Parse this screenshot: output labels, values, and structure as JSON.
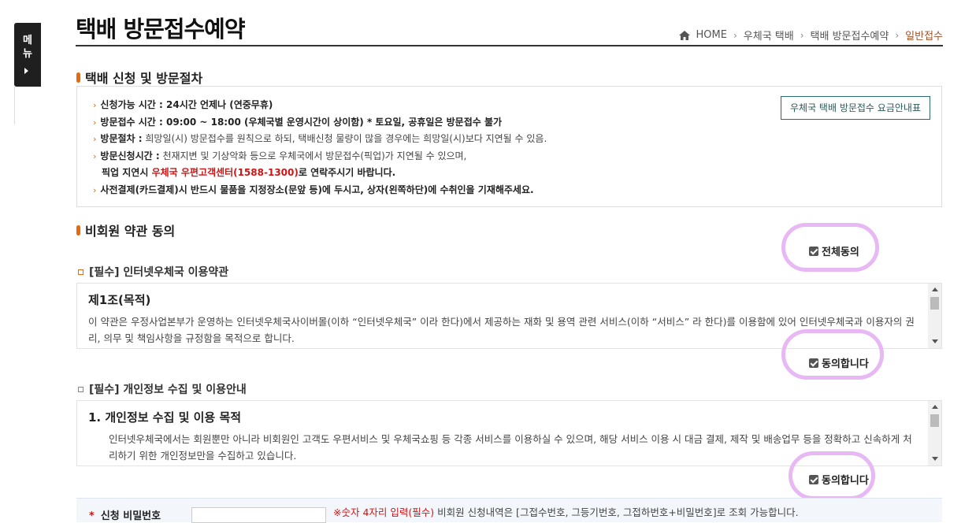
{
  "side_menu": {
    "label": "메뉴"
  },
  "header": {
    "title": "택배 방문접수예약"
  },
  "breadcrumb": {
    "home": "HOME",
    "items": [
      "우체국 택배",
      "택배 방문접수예약"
    ],
    "current": "일반접수"
  },
  "section1": {
    "title": "택배 신청 및 방문절차",
    "fee_button": "우체국 택배 방문접수 요금안내표",
    "lines": [
      {
        "label": "신청가능 시간 :",
        "text": " 24시간 언제나 (연중무휴)"
      },
      {
        "label": "방문접수 시간 :",
        "text": " 09:00 ~ 18:00 (우체국별 운영시간이 상이함) ",
        "extra": "* 토요일, 공휴일은 방문접수 불가"
      },
      {
        "label": "방문절차 :",
        "text": " 희망일(시) 방문접수를 원칙으로 하되, 택배신청 물량이 많을 경우에는 희망일(시)보다 지연될 수 있음."
      },
      {
        "label": "방문신청시간 :",
        "text": " 천재지변 및 기상악화 등으로 우체국에서 방문접수(픽업)가 지연될 수 있으며,"
      },
      {
        "pre": "픽업 지연시 ",
        "red": "우체국 우편고객센터(1588-1300)",
        "post": "로 연락주시기 바랍니다."
      },
      {
        "text": "사전결제(카드결제)시 반드시 물품을 지정장소(문앞 등)에 두시고, 상자(왼쪽하단)에 수취인을 기재해주세요."
      }
    ]
  },
  "section2": {
    "title": "비회원 약관 동의",
    "agree_all": "전체동의",
    "terms1": {
      "title": "[필수] 인터넷우체국 이용약관",
      "heading": "제1조(목적)",
      "body": "이 약관은 우정사업본부가 운영하는 인터넷우체국사이버몰(이하 “인터넷우체국” 이라 한다)에서 제공하는 재화 및 용역 관련 서비스(이하 “서비스” 라 한다)를 이용함에 있어 인터넷우체국과 이용자의 권리, 의무 및 책임사항을 규정함을 목적으로 합니다.",
      "agree": "동의합니다"
    },
    "terms2": {
      "title": "[필수] 개인정보 수집 및 이용안내",
      "heading": "1. 개인정보 수집 및 이용 목적",
      "body": "인터넷우체국에서는 회원뿐만 아니라 비회원인 고객도 우편서비스 및 우체국쇼핑 등 각종 서비스를 이용하실 수 있으며, 해당 서비스 이용 시 대금 결제, 제작 및 배송업무 등을 정확하고 신속하게 처리하기 위한 개인정보만을 수집하고 있습니다.",
      "agree": "동의합니다"
    }
  },
  "form": {
    "pw_label": "신청 비밀번호",
    "pw_note_red": "※숫자 4자리 입력(필수)",
    "pw_note": " 비회원 신청내역은 [그접수번호, 그등기번호, 그접하번호+비밀번호]로 조회 가능합니다."
  },
  "colors": {
    "accent": "#e8680c",
    "highlight": "#e7b8f3",
    "breadcrumb_current": "#a0522d",
    "warning_red": "#d01515"
  }
}
